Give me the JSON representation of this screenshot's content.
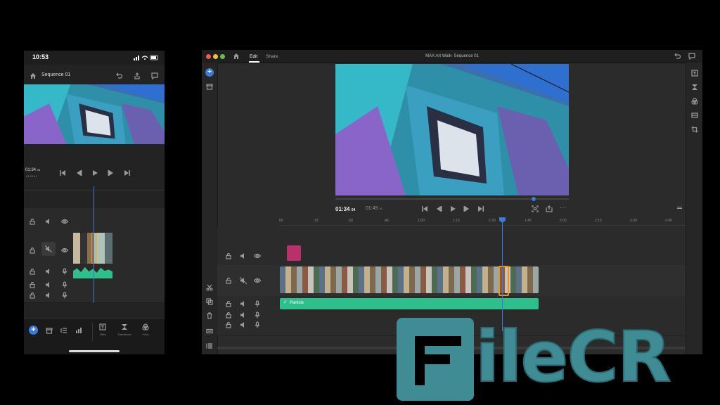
{
  "phone": {
    "status_time": "10:53",
    "sequence_title": "Sequence 01",
    "timecode": "01:34",
    "timecode_frames": "04",
    "timecode_sub": "01:49 41",
    "bottom_tools": [
      {
        "label": "Titles",
        "icon": "titles-icon"
      },
      {
        "label": "Transitions",
        "icon": "transitions-icon"
      },
      {
        "label": "Color",
        "icon": "color-icon"
      }
    ]
  },
  "desktop": {
    "tabs": [
      "Edit",
      "Share"
    ],
    "window_title": "MAX Art Walk- Sequence 01",
    "timecode": "01:34",
    "timecode_frames": "04",
    "duration": "01:49",
    "duration_frames": "41",
    "ruler_ticks": [
      "00",
      ":15",
      ":30",
      ":45",
      "1:00",
      "1:15",
      "1:30",
      "1:45",
      "2:00",
      "2:15",
      "2:30",
      "2:45"
    ],
    "audio_clip_label": "Particle"
  },
  "watermark": "FileCR",
  "colors": {
    "accent": "#3b7bd8",
    "audio": "#2fbf8c",
    "title_clip": "#b8316a",
    "selected_clip": "#e8961e",
    "watermark": "#3f8c95"
  }
}
